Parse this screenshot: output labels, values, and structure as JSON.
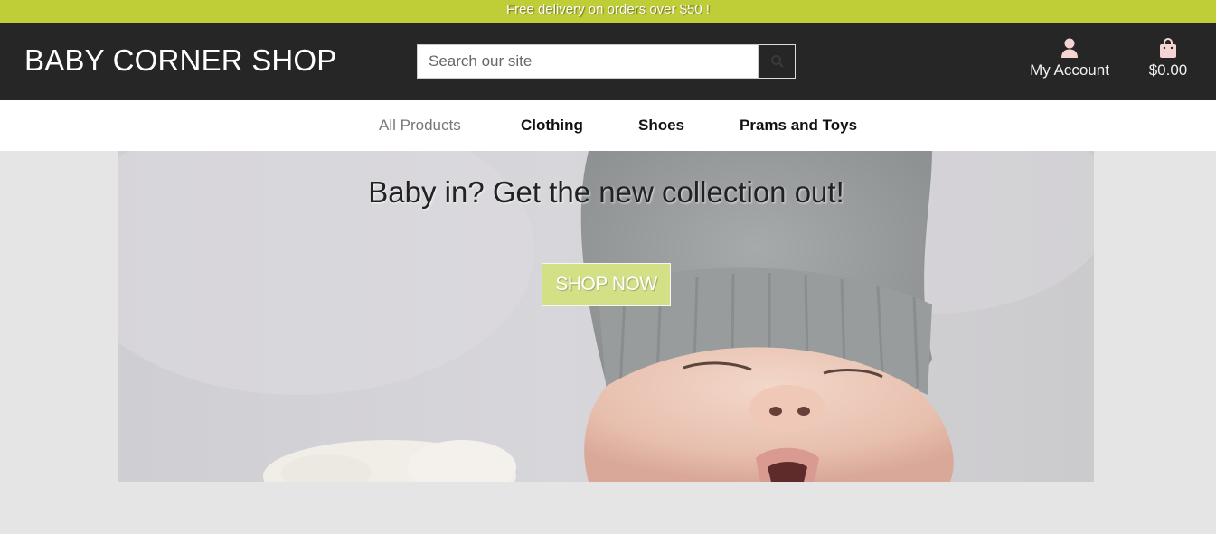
{
  "promo": {
    "text": "Free delivery on orders over $50 !"
  },
  "header": {
    "brand": "BABY CORNER SHOP",
    "search": {
      "placeholder": "Search our site",
      "value": ""
    },
    "account_label": "My Account",
    "cart_total": "$0.00"
  },
  "nav": {
    "items": [
      {
        "label": "All Products"
      },
      {
        "label": "Clothing"
      },
      {
        "label": "Shoes"
      },
      {
        "label": "Prams and Toys"
      }
    ]
  },
  "hero": {
    "heading": "Baby in? Get the new collection out!",
    "cta_label": "SHOP NOW"
  },
  "colors": {
    "accent": "#bfcd36",
    "header_bg": "#262626",
    "page_bg": "#e5e5e5",
    "icon_pink": "#f7d4d4",
    "cta_bg": "#d3e086"
  },
  "icons": {
    "search": "search-icon",
    "account": "user-icon",
    "cart": "shopping-bag-icon"
  }
}
